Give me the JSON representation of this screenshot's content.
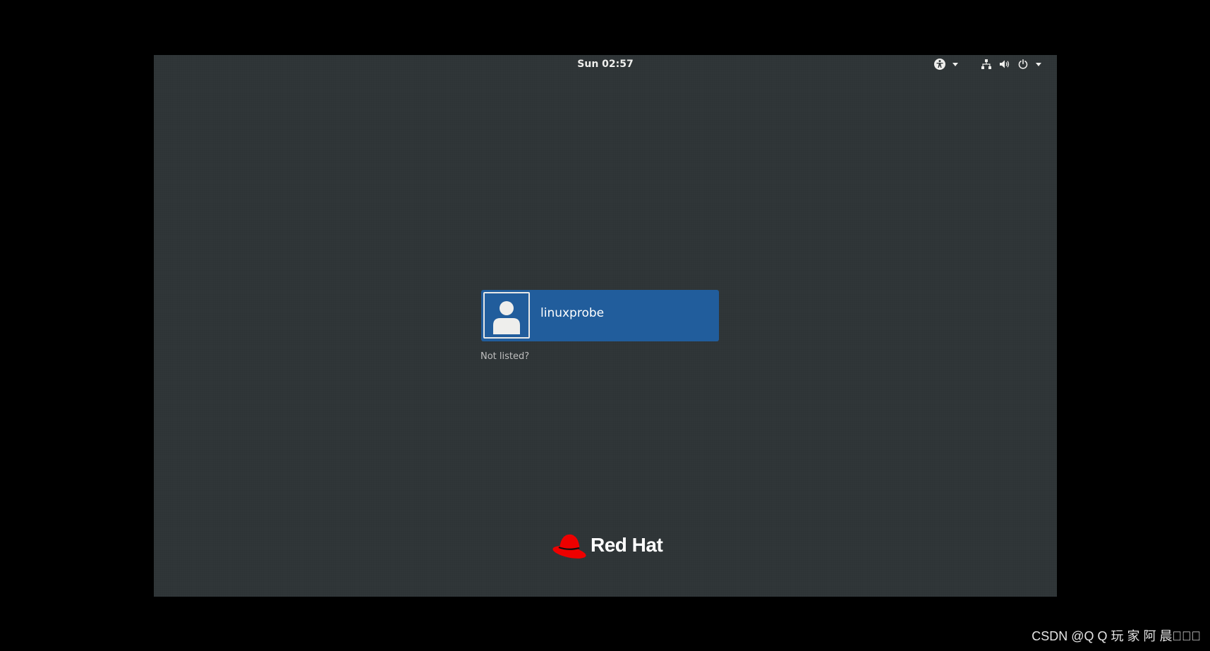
{
  "top_bar": {
    "clock": "Sun 02:57",
    "indicators": {
      "accessibility_icon": "accessibility-icon",
      "network_icon": "network-wired-icon",
      "volume_icon": "volume-icon",
      "power_icon": "power-icon"
    }
  },
  "login": {
    "users": [
      {
        "name": "linuxprobe",
        "avatar_icon": "user-avatar-icon"
      }
    ],
    "not_listed_label": "Not listed?"
  },
  "branding": {
    "logo_text": "Red Hat",
    "logo_color": "#ee0000"
  },
  "watermark": "CSDN @Q Q 玩 家 阿 晨\u0000\u0000\u0000",
  "colors": {
    "desktop_bg": "#2e3436",
    "selected_user_bg": "#215d9c",
    "outer_bg": "#000000"
  }
}
